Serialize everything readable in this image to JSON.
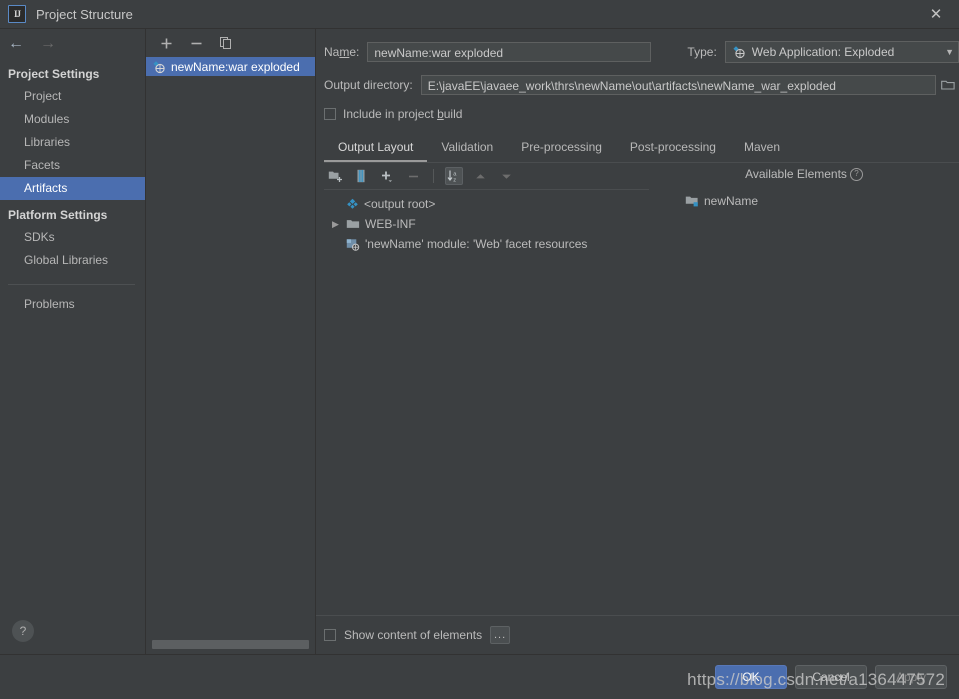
{
  "window": {
    "title": "Project Structure",
    "app_icon": "intellij-idea-icon",
    "close_icon": "close-icon"
  },
  "navigation": {
    "back_icon": "arrow-left-icon",
    "forward_icon": "arrow-right-icon"
  },
  "sidebar": {
    "sections": [
      {
        "label": "Project Settings",
        "items": [
          {
            "label": "Project",
            "selected": false
          },
          {
            "label": "Modules",
            "selected": false
          },
          {
            "label": "Libraries",
            "selected": false
          },
          {
            "label": "Facets",
            "selected": false
          },
          {
            "label": "Artifacts",
            "selected": true
          }
        ]
      },
      {
        "label": "Platform Settings",
        "items": [
          {
            "label": "SDKs",
            "selected": false
          },
          {
            "label": "Global Libraries",
            "selected": false
          }
        ]
      }
    ],
    "problems_label": "Problems",
    "help_icon": "question-mark-icon"
  },
  "artifact_panel": {
    "toolbar": {
      "add_icon": "plus-icon",
      "remove_icon": "minus-icon",
      "copy_icon": "copy-icon"
    },
    "items": [
      {
        "label": "newName:war exploded",
        "icon": "artifact-icon",
        "selected": true
      }
    ]
  },
  "form": {
    "name_label": "Name:",
    "name_label_pre": "Na",
    "name_label_mnemonic": "m",
    "name_label_post": "e:",
    "name_value": "newName:war exploded",
    "type_label": "Type:",
    "type_value": "Web Application: Exploded",
    "type_icon": "artifact-icon",
    "type_arrow_icon": "chevron-down-icon",
    "output_dir_label": "Output directory:",
    "output_dir_value": "E:\\javaEE\\javaee_work\\thrs\\newName\\out\\artifacts\\newName_war_exploded",
    "browse_icon": "folder-browse-icon",
    "include_in_build_label_pre": "Include in project ",
    "include_in_build_mnemonic": "b",
    "include_in_build_label_post": "uild",
    "include_in_build_checked": false
  },
  "tabs": [
    {
      "label": "Output Layout",
      "active": true
    },
    {
      "label": "Validation",
      "active": false
    },
    {
      "label": "Pre-processing",
      "active": false
    },
    {
      "label": "Post-processing",
      "active": false
    },
    {
      "label": "Maven",
      "active": false
    }
  ],
  "layout_toolbar": {
    "buttons": [
      {
        "name": "add-directory-icon",
        "state": "enabled"
      },
      {
        "name": "add-archive-icon",
        "state": "enabled"
      },
      {
        "name": "add-copy-icon",
        "state": "enabled"
      },
      {
        "name": "remove-icon",
        "state": "disabled"
      },
      {
        "name": "sort-alphabetically-icon",
        "state": "pressed"
      },
      {
        "name": "move-up-icon",
        "state": "disabled"
      },
      {
        "name": "move-down-icon",
        "state": "disabled"
      }
    ]
  },
  "output_layout_tree": [
    {
      "label": "<output root>",
      "icon": "artifact-root-icon",
      "expandable": false,
      "expanded": false,
      "indent": 0
    },
    {
      "label": "WEB-INF",
      "icon": "folder-icon",
      "expandable": true,
      "expanded": false,
      "indent": 1
    },
    {
      "label": "'newName' module: 'Web' facet resources",
      "icon": "facet-resources-icon",
      "expandable": false,
      "expanded": false,
      "indent": 1
    }
  ],
  "available_elements": {
    "title": "Available Elements",
    "help_icon": "question-circle-icon",
    "items": [
      {
        "label": "newName",
        "icon": "module-folder-icon"
      }
    ]
  },
  "bottom_options": {
    "show_content_label": "Show content of elements",
    "show_content_checked": false,
    "more_button_label": "..."
  },
  "dialog_buttons": [
    {
      "label": "OK",
      "primary": true,
      "disabled": false
    },
    {
      "label": "Cancel",
      "primary": false,
      "disabled": false
    },
    {
      "label": "Apply",
      "primary": false,
      "disabled": true
    }
  ],
  "watermark": {
    "text": "https://blog.csdn.net/a136447572"
  },
  "colors": {
    "background": "#3c3f41",
    "accent_selection": "#4b6eaf",
    "text": "#bbbbbb",
    "input_background": "#45494a",
    "border": "#5e6060"
  }
}
